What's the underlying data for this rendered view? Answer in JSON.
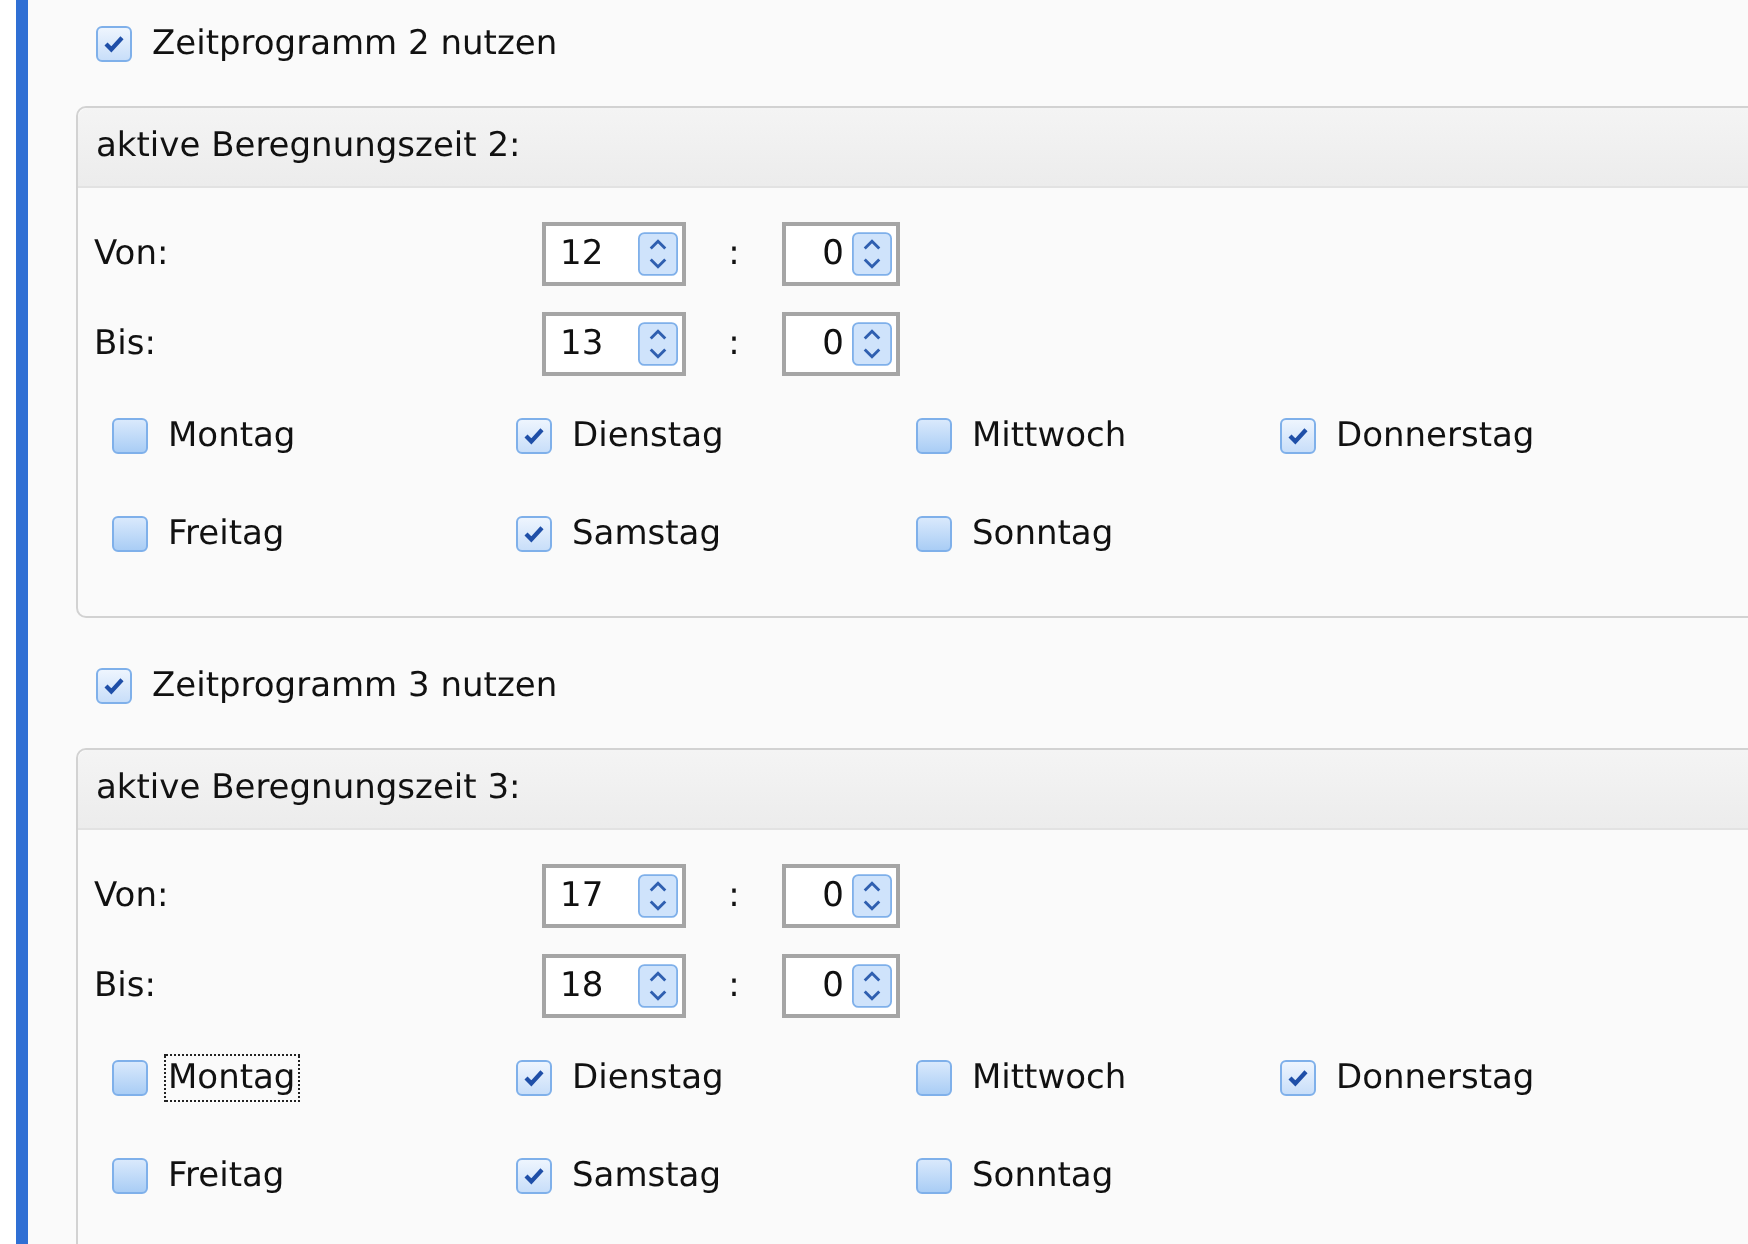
{
  "programs": [
    {
      "use_label": "Zeitprogramm 2 nutzen",
      "checked": true,
      "group_title": "aktive Beregnungszeit 2:",
      "times": [
        {
          "label": "Von:",
          "hour": "12",
          "separator": ":",
          "minute": "0"
        },
        {
          "label": "Bis:",
          "hour": "13",
          "separator": ":",
          "minute": "0"
        }
      ],
      "days": [
        {
          "label": "Montag",
          "checked": false,
          "focused": false
        },
        {
          "label": "Dienstag",
          "checked": true,
          "focused": false
        },
        {
          "label": "Mittwoch",
          "checked": false,
          "focused": false
        },
        {
          "label": "Donnerstag",
          "checked": true,
          "focused": false
        },
        {
          "label": "Freitag",
          "checked": false,
          "focused": false
        },
        {
          "label": "Samstag",
          "checked": true,
          "focused": false
        },
        {
          "label": "Sonntag",
          "checked": false,
          "focused": false
        }
      ]
    },
    {
      "use_label": "Zeitprogramm 3 nutzen",
      "checked": true,
      "group_title": "aktive Beregnungszeit 3:",
      "times": [
        {
          "label": "Von:",
          "hour": "17",
          "separator": ":",
          "minute": "0"
        },
        {
          "label": "Bis:",
          "hour": "18",
          "separator": ":",
          "minute": "0"
        }
      ],
      "days": [
        {
          "label": "Montag",
          "checked": false,
          "focused": true
        },
        {
          "label": "Dienstag",
          "checked": true,
          "focused": false
        },
        {
          "label": "Mittwoch",
          "checked": false,
          "focused": false
        },
        {
          "label": "Donnerstag",
          "checked": true,
          "focused": false
        },
        {
          "label": "Freitag",
          "checked": false,
          "focused": false
        },
        {
          "label": "Samstag",
          "checked": true,
          "focused": false
        },
        {
          "label": "Sonntag",
          "checked": false,
          "focused": false
        }
      ]
    }
  ]
}
